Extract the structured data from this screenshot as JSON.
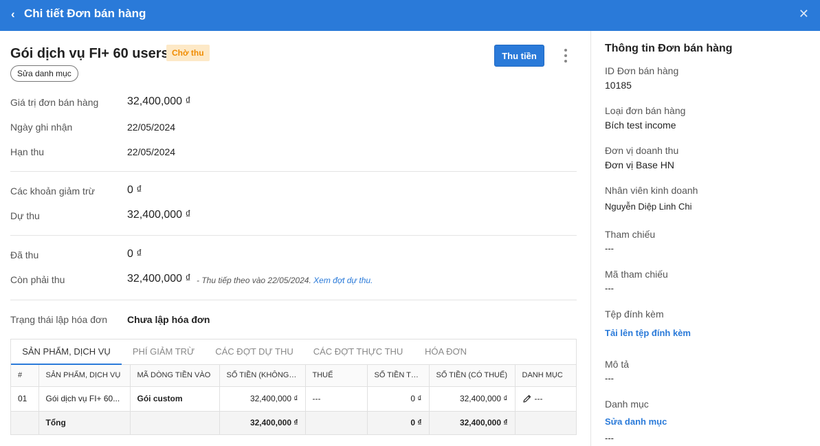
{
  "header": {
    "back_icon": "‹",
    "title": "Chi tiết Đơn bán hàng",
    "close_icon": "✕"
  },
  "order": {
    "name": "Gói dịch vụ FI+ 60 users",
    "status": "Chờ thu",
    "edit_category_label": "Sửa danh mục",
    "collect_button_label": "Thu tiền"
  },
  "fields": {
    "order_value_label": "Giá trị đơn bán hàng",
    "order_value": "32,400,000 ₫",
    "record_date_label": "Ngày ghi nhận",
    "record_date": "22/05/2024",
    "due_date_label": "Hạn thu",
    "due_date": "22/05/2024",
    "deductions_label": "Các khoản giảm trừ",
    "deductions": "0 ₫",
    "expected_label": "Dự thu",
    "expected": "32,400,000 ₫",
    "collected_label": "Đã thu",
    "collected": "0 ₫",
    "remaining_label": "Còn phải thu",
    "remaining": "32,400,000 ₫",
    "remaining_note": "- Thu tiếp theo vào 22/05/2024.",
    "remaining_link": "Xem đợt dự thu.",
    "invoice_status_label": "Trạng thái lập hóa đơn",
    "invoice_status": "Chưa lập hóa đơn"
  },
  "tabs": [
    {
      "label": "SẢN PHẨM, DỊCH VỤ",
      "active": true
    },
    {
      "label": "PHÍ GIẢM TRỪ",
      "active": false
    },
    {
      "label": "CÁC ĐỢT DỰ THU",
      "active": false
    },
    {
      "label": "CÁC ĐỢT THỰC THU",
      "active": false
    },
    {
      "label": "HÓA ĐƠN",
      "active": false
    }
  ],
  "table": {
    "headers": [
      "#",
      "SẢN PHẨM, DỊCH VỤ",
      "MÃ DÒNG TIỀN VÀO",
      "SỐ TIỀN (KHÔNG T...",
      "THUẾ",
      "SỐ TIỀN THUẾ",
      "SỐ TIỀN (CÓ THUẾ)",
      "DANH MỤC"
    ],
    "rows": [
      [
        "01",
        "Gói dịch vụ FI+ 60...",
        "Gói custom",
        "32,400,000 ₫",
        "---",
        "0 ₫",
        "32,400,000 ₫",
        "---"
      ]
    ],
    "total": [
      "",
      "Tổng",
      "",
      "32,400,000 ₫",
      "",
      "0 ₫",
      "32,400,000 ₫",
      ""
    ]
  },
  "sidebar": {
    "title": "Thông tin Đơn bán hàng",
    "id_label": "ID Đơn bán hàng",
    "id_value": "10185",
    "type_label": "Loại đơn bán hàng",
    "type_value": "Bích test income",
    "unit_label": "Đơn vị doanh thu",
    "unit_value": "Đơn vị Base HN",
    "staff_label": "Nhân viên kinh doanh",
    "staff_value": "Nguyễn Diệp Linh Chi",
    "ref_label": "Tham chiếu",
    "ref_value": "---",
    "ref_code_label": "Mã tham chiếu",
    "ref_code_value": "---",
    "attach_label": "Tệp đính kèm",
    "attach_link": "Tải lên tệp đính kèm",
    "desc_label": "Mô tả",
    "desc_value": "---",
    "category_label": "Danh mục",
    "category_link": "Sửa danh mục",
    "category_value": "---"
  },
  "colors": {
    "primary": "#2a7ad9",
    "status_bg": "#fde9c7",
    "status_text": "#f08c00"
  },
  "icons": {
    "back": "chevron-left-icon",
    "close": "close-icon",
    "more": "more-vertical-icon",
    "edit": "pencil-icon"
  }
}
